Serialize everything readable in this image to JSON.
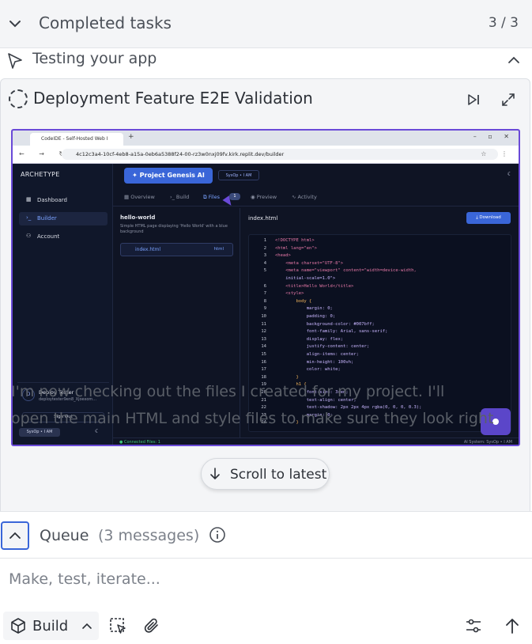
{
  "completed": {
    "title": "Completed tasks",
    "count": "3 / 3"
  },
  "testing": {
    "title": "Testing your app"
  },
  "card": {
    "title": "Deployment Feature E2E Validation"
  },
  "screenshot": {
    "tab_title": "CodeIDE - Self-Hosted Web I",
    "url": "4c12c3a4-10cf-4eb8-a15a-0eb6a5388f24-00-rz3w0nxj09fv.kirk.replit.dev/builder",
    "logo": "ARCHETYPE",
    "nav": [
      "Dashboard",
      "Builder",
      "Account"
    ],
    "user_name": "Deploy Tester",
    "user_email": "deploytester9en8_Xjoexom...",
    "sign_out": "Sign Out",
    "sysop_badge": "SysOp • I AM",
    "project_button": "Project Genesis AI",
    "project_badge": "SysOp • I AM",
    "tabs": [
      "Overview",
      "Build",
      "Files",
      "Preview",
      "Activity"
    ],
    "files_badge": "1",
    "project_name": "hello-world",
    "project_desc": "Simple HTML page displaying 'Hello World' with a blue background",
    "file_name": "index.html",
    "file_type": "html",
    "editor_file": "index.html",
    "download": "Download",
    "status_left": "● Connected   Files: 1",
    "status_right": "AI System: SysOp • I AM",
    "code_lines": [
      [
        "1",
        "<!DOCTYPE html>"
      ],
      [
        "2",
        "<html lang=\"en\">"
      ],
      [
        "3",
        "<head>"
      ],
      [
        "4",
        "    <meta charset=\"UTF-8\">"
      ],
      [
        "5",
        "    <meta name=\"viewport\" content=\"width=device-width,"
      ],
      [
        "",
        "    initial-scale=1.0\">"
      ],
      [
        "6",
        "    <title>Hello World</title>"
      ],
      [
        "7",
        "    <style>"
      ],
      [
        "8",
        "        body {"
      ],
      [
        "9",
        "            margin: 0;"
      ],
      [
        "10",
        "            padding: 0;"
      ],
      [
        "11",
        "            background-color: #007bff;"
      ],
      [
        "12",
        "            font-family: Arial, sans-serif;"
      ],
      [
        "13",
        "            display: flex;"
      ],
      [
        "14",
        "            justify-content: center;"
      ],
      [
        "15",
        "            align-items: center;"
      ],
      [
        "16",
        "            min-height: 100vh;"
      ],
      [
        "17",
        "            color: white;"
      ],
      [
        "18",
        "        }"
      ],
      [
        "19",
        "        h1 {"
      ],
      [
        "20",
        "            font-size: 3rem;"
      ],
      [
        "21",
        "            text-align: center;"
      ],
      [
        "22",
        "            text-shadow: 2px 2px 4px rgba(0, 0, 0, 0.3);"
      ],
      [
        "23",
        "            margin: 0;"
      ],
      [
        "24",
        "        }"
      ]
    ]
  },
  "message": {
    "line1": "I'm now checking out the files I created for my project. I'll",
    "line2": "open the main HTML and style files to make sure they look right"
  },
  "scroll_button": "Scroll to latest",
  "queue": {
    "label": "Queue",
    "count": "(3 messages)"
  },
  "prompt": {
    "placeholder": "Make, test, iterate..."
  },
  "toolbar": {
    "build_label": "Build"
  },
  "colors": {
    "accent": "#3a66d8",
    "purple": "#6a4ad8",
    "dark_bg": "#0f1424"
  }
}
